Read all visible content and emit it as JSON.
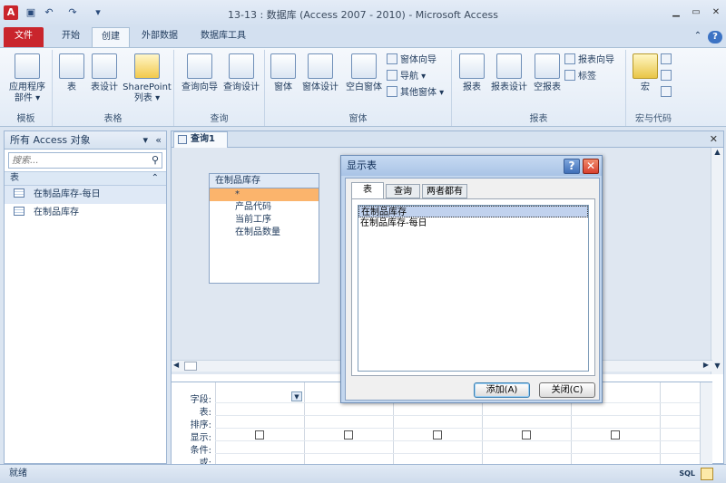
{
  "window": {
    "title": "13-13 : 数据库 (Access 2007 - 2010)  -  Microsoft Access"
  },
  "ribbon_tabs": [
    "文件",
    "开始",
    "创建",
    "外部数据",
    "数据库工具"
  ],
  "ribbon": {
    "groups": [
      {
        "label": "模板",
        "buttons": [
          "应用程序\n部件 ▾"
        ]
      },
      {
        "label": "表格",
        "buttons": [
          "表",
          "表设计",
          "SharePoint\n列表 ▾"
        ]
      },
      {
        "label": "查询",
        "buttons": [
          "查询向导",
          "查询设计"
        ]
      },
      {
        "label": "窗体",
        "buttons": [
          "窗体",
          "窗体设计",
          "空白窗体"
        ],
        "small": [
          "窗体向导",
          "导航 ▾",
          "其他窗体 ▾"
        ]
      },
      {
        "label": "报表",
        "buttons": [
          "报表",
          "报表设计",
          "空报表"
        ],
        "small": [
          "报表向导",
          "标签"
        ]
      },
      {
        "label": "宏与代码",
        "buttons": [
          "宏"
        ]
      }
    ]
  },
  "nav_pane": {
    "header": "所有 Access 对象",
    "search_placeholder": "搜索...",
    "section": "表",
    "items": [
      "在制品库存-每日",
      "在制品库存"
    ]
  },
  "document": {
    "tab": "查询1",
    "table_box": {
      "title": "在制品库存",
      "fields": [
        "*",
        "产品代码",
        "当前工序",
        "在制品数量"
      ]
    },
    "grid_row_labels": [
      "字段:",
      "表:",
      "排序:",
      "显示:",
      "条件:",
      "或:"
    ]
  },
  "dialog": {
    "title": "显示表",
    "tabs": [
      "表",
      "查询",
      "两者都有"
    ],
    "list": [
      "在制品库存",
      "在制品库存-每日"
    ],
    "add_label": "添加(A)",
    "close_label": "关闭(C)"
  },
  "status": {
    "text": "就绪",
    "sql": "SQL"
  },
  "colors": {
    "file_tab": "#c9252c",
    "star_field": "#fbb46c",
    "close_x": "#d9412f"
  }
}
